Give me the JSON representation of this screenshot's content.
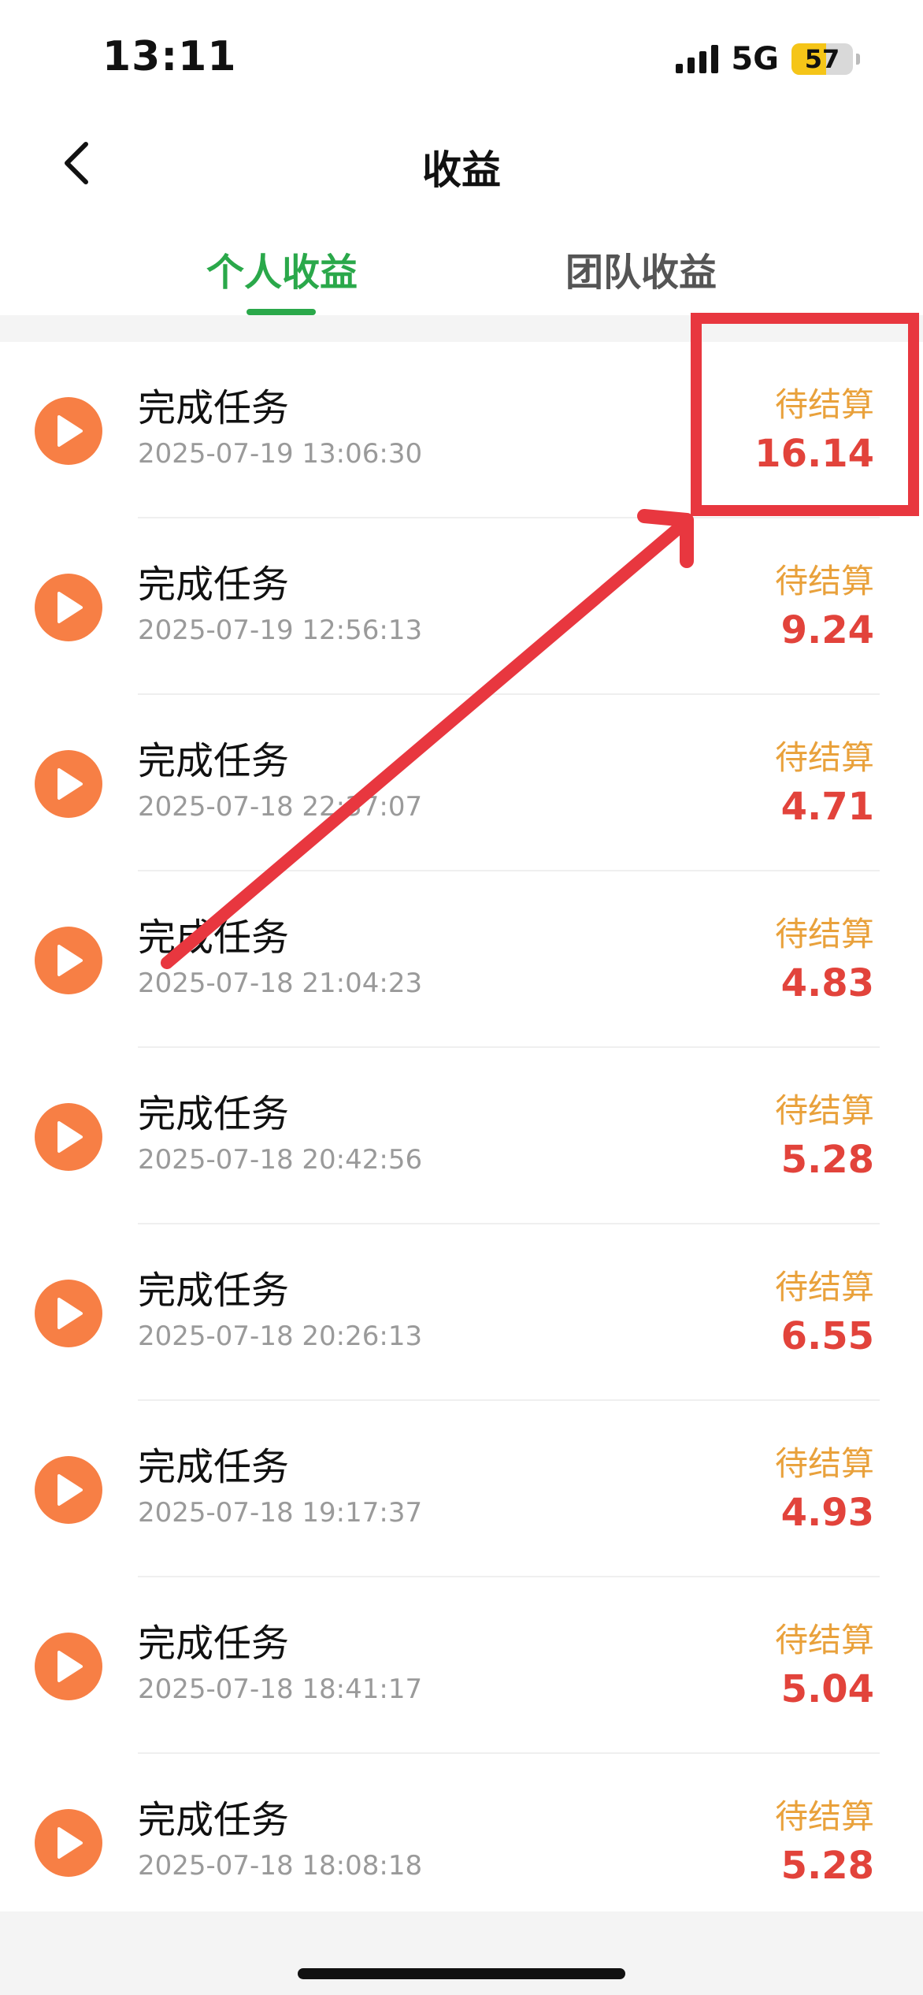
{
  "status_bar": {
    "time": "13:11",
    "network": "5G",
    "battery_level": "57"
  },
  "nav": {
    "title": "收益"
  },
  "tabs": [
    {
      "label": "个人收益",
      "active": true
    },
    {
      "label": "团队收益",
      "active": false
    }
  ],
  "records": [
    {
      "title": "完成任务",
      "time": "2025-07-19 13:06:30",
      "status": "待结算",
      "amount": "16.14"
    },
    {
      "title": "完成任务",
      "time": "2025-07-19 12:56:13",
      "status": "待结算",
      "amount": "9.24"
    },
    {
      "title": "完成任务",
      "time": "2025-07-18 22:37:07",
      "status": "待结算",
      "amount": "4.71"
    },
    {
      "title": "完成任务",
      "time": "2025-07-18 21:04:23",
      "status": "待结算",
      "amount": "4.83"
    },
    {
      "title": "完成任务",
      "time": "2025-07-18 20:42:56",
      "status": "待结算",
      "amount": "5.28"
    },
    {
      "title": "完成任务",
      "time": "2025-07-18 20:26:13",
      "status": "待结算",
      "amount": "6.55"
    },
    {
      "title": "完成任务",
      "time": "2025-07-18 19:17:37",
      "status": "待结算",
      "amount": "4.93"
    },
    {
      "title": "完成任务",
      "time": "2025-07-18 18:41:17",
      "status": "待结算",
      "amount": "5.04"
    },
    {
      "title": "完成任务",
      "time": "2025-07-18 18:08:18",
      "status": "待结算",
      "amount": "5.28"
    }
  ],
  "colors": {
    "accent_green": "#2aa84a",
    "play_orange": "#f77f45",
    "status_orange": "#e9a13b",
    "amount_red": "#e2433b",
    "annotation_red": "#e8373f"
  },
  "icons": {
    "back": "chevron-left-icon",
    "row": "play-icon"
  }
}
